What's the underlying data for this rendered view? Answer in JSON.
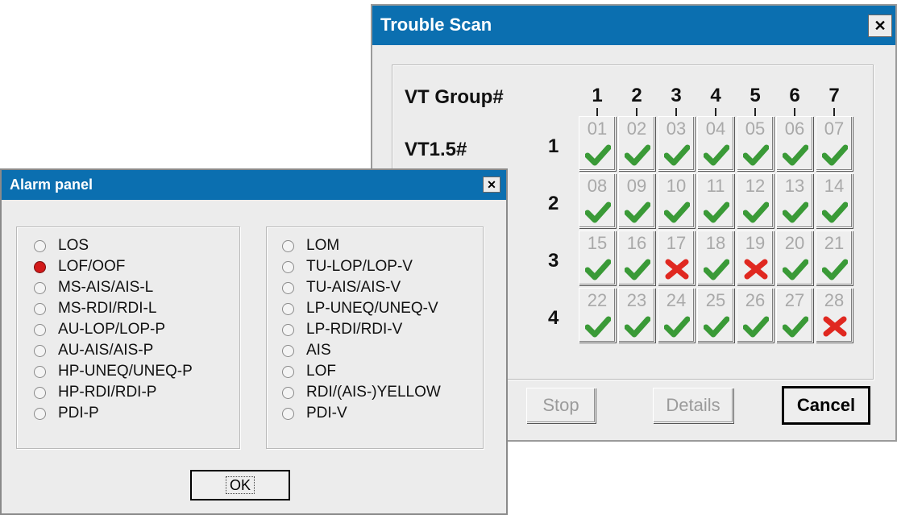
{
  "trouble_scan": {
    "title": "Trouble Scan",
    "close_label": "✕",
    "vt_group_label": "VT Group#",
    "vt15_label": "VT1.5#",
    "groups": [
      "1",
      "2",
      "3",
      "4",
      "5",
      "6",
      "7"
    ],
    "rows": [
      {
        "label": "1",
        "cells": [
          {
            "num": "01",
            "status": "ok"
          },
          {
            "num": "02",
            "status": "ok"
          },
          {
            "num": "03",
            "status": "ok"
          },
          {
            "num": "04",
            "status": "ok"
          },
          {
            "num": "05",
            "status": "ok"
          },
          {
            "num": "06",
            "status": "ok"
          },
          {
            "num": "07",
            "status": "ok"
          }
        ]
      },
      {
        "label": "2",
        "cells": [
          {
            "num": "08",
            "status": "ok"
          },
          {
            "num": "09",
            "status": "ok"
          },
          {
            "num": "10",
            "status": "ok"
          },
          {
            "num": "11",
            "status": "ok"
          },
          {
            "num": "12",
            "status": "ok"
          },
          {
            "num": "13",
            "status": "ok"
          },
          {
            "num": "14",
            "status": "ok"
          }
        ]
      },
      {
        "label": "3",
        "cells": [
          {
            "num": "15",
            "status": "ok"
          },
          {
            "num": "16",
            "status": "ok"
          },
          {
            "num": "17",
            "status": "error"
          },
          {
            "num": "18",
            "status": "ok"
          },
          {
            "num": "19",
            "status": "error"
          },
          {
            "num": "20",
            "status": "ok"
          },
          {
            "num": "21",
            "status": "ok"
          }
        ]
      },
      {
        "label": "4",
        "cells": [
          {
            "num": "22",
            "status": "ok"
          },
          {
            "num": "23",
            "status": "ok"
          },
          {
            "num": "24",
            "status": "ok"
          },
          {
            "num": "25",
            "status": "ok"
          },
          {
            "num": "26",
            "status": "ok"
          },
          {
            "num": "27",
            "status": "ok"
          },
          {
            "num": "28",
            "status": "error"
          }
        ]
      }
    ],
    "buttons": {
      "stop": "Stop",
      "details": "Details",
      "cancel": "Cancel"
    },
    "colors": {
      "title_bar": "#0b6fb0",
      "ok": "#3a9a37",
      "error": "#e02820"
    }
  },
  "alarm_panel": {
    "title": "Alarm panel",
    "close_label": "✕",
    "left_options": [
      "LOS",
      "LOF/OOF",
      "MS-AIS/AIS-L",
      "MS-RDI/RDI-L",
      "AU-LOP/LOP-P",
      "AU-AIS/AIS-P",
      "HP-UNEQ/UNEQ-P",
      "HP-RDI/RDI-P",
      "PDI-P"
    ],
    "right_options": [
      "LOM",
      "TU-LOP/LOP-V",
      "TU-AIS/AIS-V",
      "LP-UNEQ/UNEQ-V",
      "LP-RDI/RDI-V",
      "AIS",
      "LOF",
      "RDI/(AIS-)YELLOW",
      "PDI-V"
    ],
    "selected": "LOF/OOF",
    "ok_label": "OK"
  },
  "icons": {
    "ok": "check-icon",
    "error": "cross-icon"
  }
}
